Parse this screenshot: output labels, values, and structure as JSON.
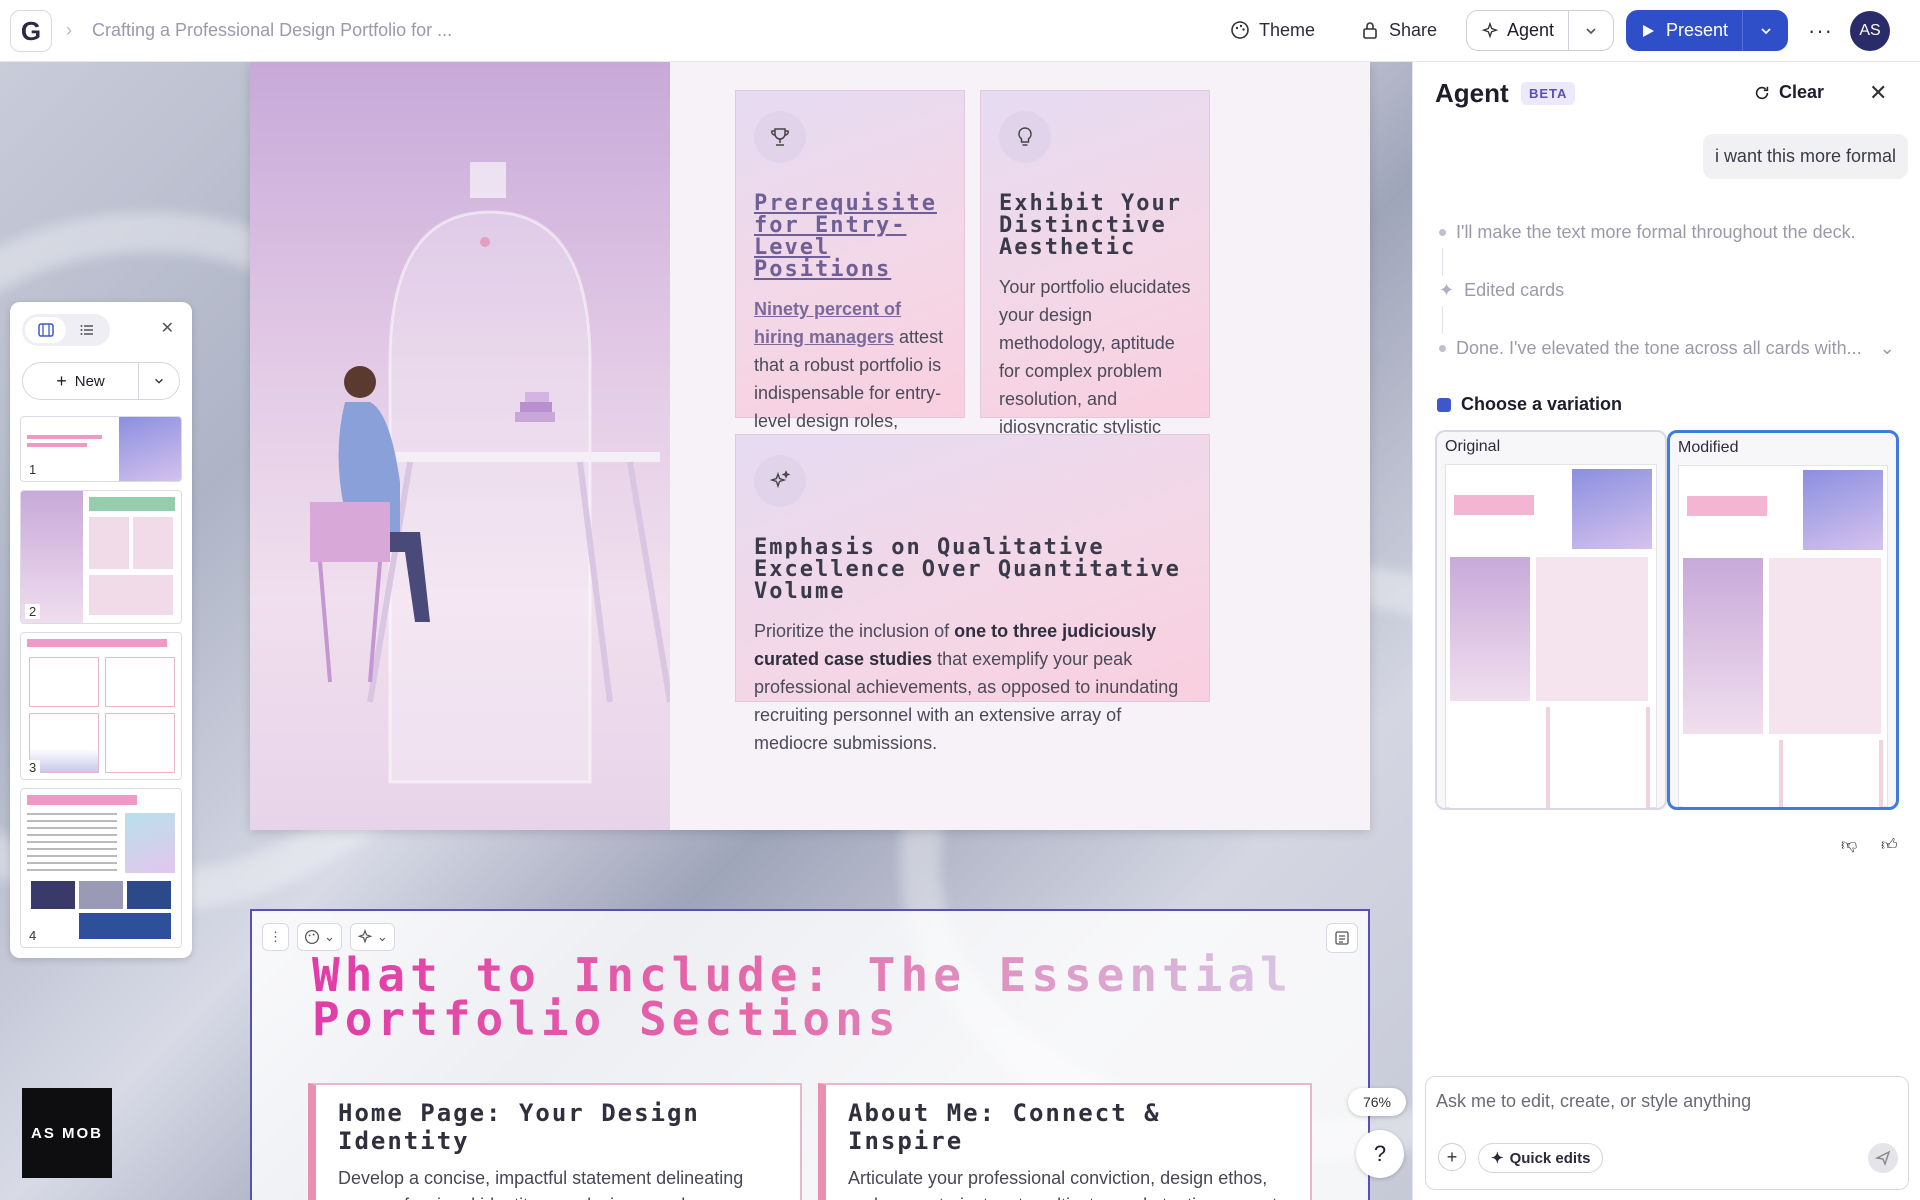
{
  "header": {
    "logo_letter": "G",
    "breadcrumb": "Crafting a Professional Design Portfolio for ...",
    "theme_label": "Theme",
    "share_label": "Share",
    "agent_label": "Agent",
    "present_label": "Present",
    "more": "···",
    "avatar_initials": "AS"
  },
  "pages_panel": {
    "new_label": "New",
    "thumbnails": [
      {
        "number": "1"
      },
      {
        "number": "2"
      },
      {
        "number": "3"
      },
      {
        "number": "4"
      }
    ]
  },
  "slide": {
    "card1": {
      "title": "Prerequisite for Entry-Level Positions",
      "body_link": "Ninety percent of hiring managers",
      "body": " attest that a robust portfolio is indispensable for entry-level design roles, effectively demonstrating practical competencies beyond rudimentary qualifications."
    },
    "card2": {
      "title": "Exhibit Your Distinctive Aesthetic",
      "body": "Your portfolio elucidates your design methodology, aptitude for complex problem resolution, and idiosyncratic stylistic approach, thereby differentiating your profile from that of other applicants."
    },
    "card3": {
      "title": "Emphasis on Qualitative Excellence Over Quantitative Volume",
      "body_pre": "Prioritize the inclusion of ",
      "body_bold": "one to three judiciously curated case studies",
      "body_post": " that exemplify your peak professional achievements, as opposed to inundating recruiting personnel with an extensive array of mediocre submissions."
    }
  },
  "section": {
    "title": "What to Include: The Essential Portfolio Sections",
    "card_left": {
      "title": "Home Page: Your Design Identity",
      "body": "Develop a concise, impactful statement delineating your professional identity as a designer and your specialized expertise, thereby immediately securing"
    },
    "card_right": {
      "title": "About Me: Connect & Inspire",
      "body": "Articulate your professional conviction, design ethos, and career trajectory to cultivate a substantive rapport with prospective employers and illustrate your"
    }
  },
  "zoom_level": "76%",
  "help_label": "?",
  "brand_text": "AS MOB",
  "agent_panel": {
    "title": "Agent",
    "beta": "BETA",
    "clear_label": "Clear",
    "user_message": "i want this more formal",
    "step1": "I'll make the text more formal throughout the deck.",
    "step2": "Edited cards",
    "step3": "Done. I've elevated the tone across all cards with...",
    "choose_label": "Choose a variation",
    "original_label": "Original",
    "modified_label": "Modified",
    "input_placeholder": "Ask me to edit, create, or style anything",
    "quick_edits_label": "Quick edits"
  },
  "colors": {
    "primary": "#2f4fc9",
    "accent_pink": "#e23ba8",
    "selection": "#5a4fb8"
  }
}
